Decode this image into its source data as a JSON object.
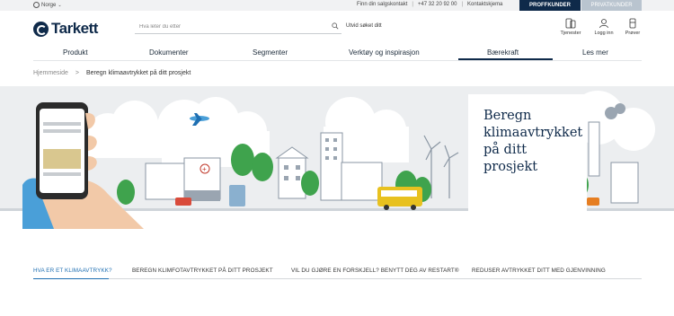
{
  "topbar": {
    "region": "Norge",
    "links": [
      "Finn din salgskontakt",
      "+47 32 20 92 00",
      "Kontaktskjema"
    ],
    "pro_button": "PROFFKUNDER",
    "private_button": "PRIVATKUNDER"
  },
  "header": {
    "logo": "Tarkett",
    "search_placeholder": "Hva leter du etter",
    "advanced_search": "Utvid søket ditt",
    "icons": [
      {
        "label": "Tjenester",
        "icon": "phone-tablet-icon"
      },
      {
        "label": "Logg inn",
        "icon": "user-icon"
      },
      {
        "label": "Prøver",
        "icon": "samples-icon"
      }
    ]
  },
  "nav": {
    "items": [
      "Produkt",
      "Dokumenter",
      "Segmenter",
      "Verktøy og inspirasjon",
      "Bærekraft",
      "Les mer"
    ],
    "active": "Bærekraft"
  },
  "breadcrumb": {
    "home": "Hjemmeside",
    "separator": ">",
    "current": "Beregn klimaavtrykket på ditt prosjekt"
  },
  "hero": {
    "title": "Beregn klimaavtrykket på ditt prosjekt"
  },
  "tabs": {
    "items": [
      "HVA ER ET KLIMAAVTRYKK?",
      "BEREGN KLIMFOTAVTRYKKET PÅ DITT PROSJEKT",
      "VIL DU GJØRE EN FORSKJELL? BENYTT DEG AV RESTART®",
      "REDUSER AVTRYKKET DITT MED GJENVINNING"
    ],
    "active": "HVA ER ET KLIMAAVTRYKK?"
  },
  "colors": {
    "brand_navy": "#0f2a4a",
    "accent_blue": "#1f6fb2",
    "tree_green": "#3fa34d",
    "bus_yellow": "#e8c11f"
  }
}
